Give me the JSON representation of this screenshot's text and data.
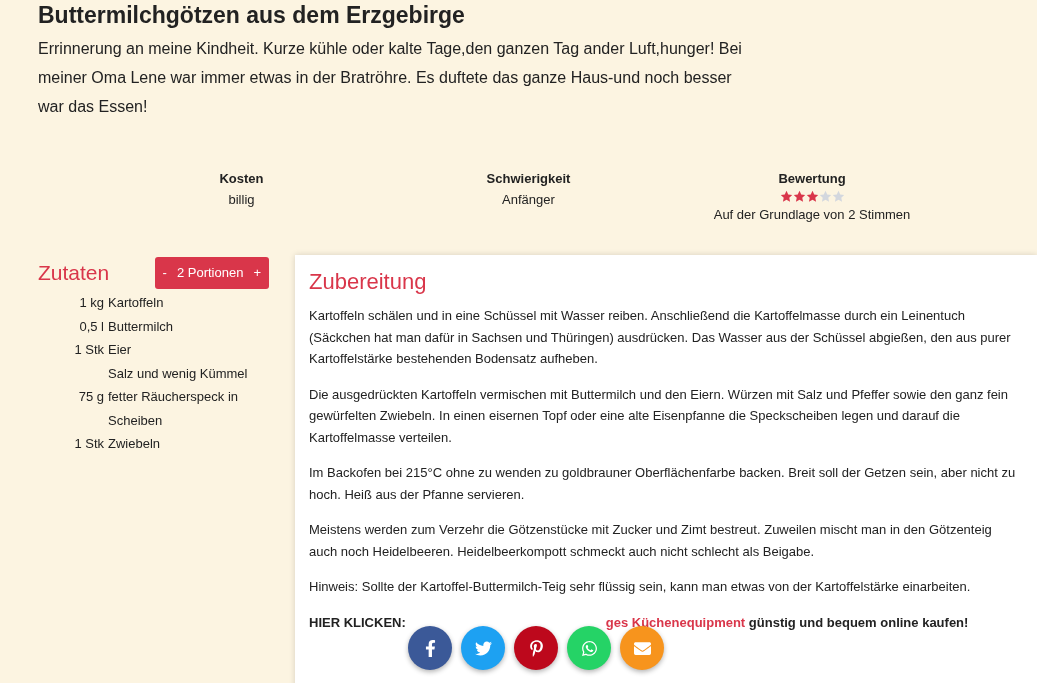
{
  "recipe": {
    "title": "Buttermilchgötzen aus dem Erzgebirge",
    "description": "Errinnerung an meine Kindheit. Kurze kühle oder kalte Tage,den ganzen Tag ander Luft,hunger! Bei meiner Oma Lene war immer etwas in der Bratröhre. Es duftete das ganze Haus-und noch besser war das Essen!"
  },
  "facts": [
    {
      "label": "Kosten",
      "value": "billig"
    },
    {
      "label": "Schwierigkeit",
      "value": "Anfänger"
    }
  ],
  "rating": {
    "label": "Bewertung",
    "stars": 3,
    "note": "Auf der Grundlage von 2 Stimmen"
  },
  "ingredients": {
    "title": "Zutaten",
    "portions": {
      "minus": "-",
      "label": "2 Portionen",
      "plus": "+"
    },
    "items": [
      {
        "amount": "1 kg",
        "name": "Kartoffeln"
      },
      {
        "amount": "0,5 l",
        "name": "Buttermilch"
      },
      {
        "amount": "1 Stk",
        "name": "Eier"
      },
      {
        "name": "Salz und wenig Kümmel"
      },
      {
        "amount": "75 g",
        "name": "fetter Räucherspeck in Scheiben"
      },
      {
        "amount": "1 Stk",
        "name": "Zwiebeln"
      }
    ]
  },
  "preparation": {
    "title": "Zubereitung",
    "paragraphs": [
      "Kartoffeln schälen und in eine Schüssel mit Wasser reiben. Anschließend die Kartoffelmasse durch ein Leinentuch (Säckchen hat man dafür in Sachsen und Thüringen) ausdrücken. Das Wasser aus der Schüssel abgießen, den aus purer Kartoffelstärke bestehenden Bodensatz aufheben.",
      "Die ausgedrückten Kartoffeln vermischen mit Buttermilch und den Eiern. Würzen mit Salz und Pfeffer sowie den ganz fein gewürfelten Zwiebeln. In einen eisernen Topf oder eine alte Eisenpfanne die Speckscheiben legen und darauf die Kartoffelmasse verteilen.",
      "Im Backofen bei 215°C ohne zu wenden zu goldbrauner Oberflächenfarbe backen. Breit soll der Getzen sein, aber nicht zu hoch. Heiß aus der Pfanne servieren.",
      "Meistens werden zum Verzehr die Götzenstücke mit Zucker und Zimt bestreut. Zuweilen mischt man in den Götzenteig auch noch Heidelbeeren. Heidelbeerkompott schmeckt auch nicht schlecht als Beigabe.",
      "Hinweis: Sollte der Kartoffel-Buttermilch-Teig sehr flüssig sein, kann man etwas von der Kartoffelstärke einarbeiten."
    ],
    "promo": {
      "lead": "HIER KLICKEN:",
      "link": "ges Küchenequipment",
      "tail": "günstig und bequem online kaufen!"
    }
  },
  "share": [
    {
      "kind": "facebook"
    },
    {
      "kind": "twitter"
    },
    {
      "kind": "pinterest"
    },
    {
      "kind": "whatsapp"
    },
    {
      "kind": "email"
    }
  ]
}
